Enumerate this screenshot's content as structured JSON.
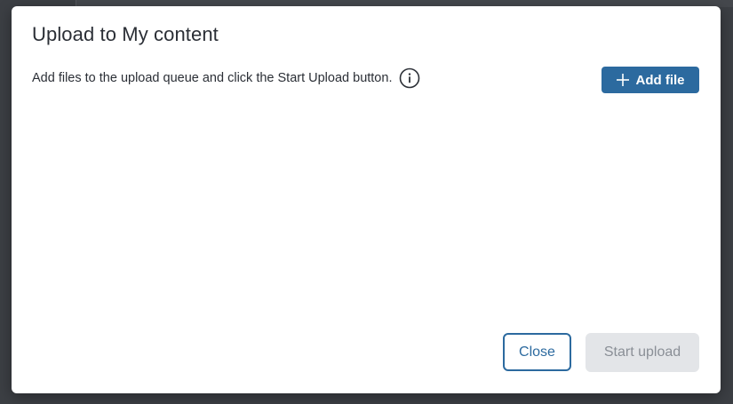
{
  "dialog": {
    "title": "Upload to My content",
    "instructions": "Add files to the upload queue and click the Start Upload button.",
    "info_icon": "info-circle-icon",
    "add_file_label": "Add file",
    "add_file_icon": "plus-icon",
    "close_label": "Close",
    "start_upload_label": "Start upload",
    "start_upload_enabled": false,
    "queue_items": []
  },
  "colors": {
    "primary": "#2c6a9f",
    "disabled_bg": "#e3e5e8",
    "disabled_text": "#8a8f96",
    "text": "#2b2f36",
    "backdrop": "#3c3f44"
  }
}
